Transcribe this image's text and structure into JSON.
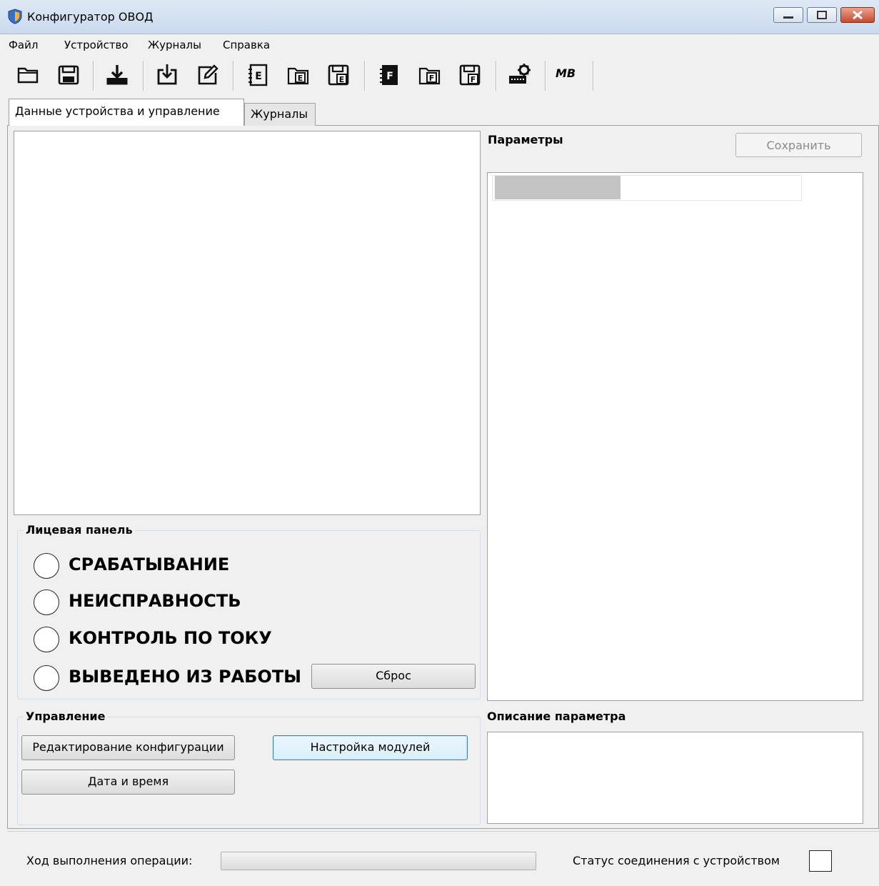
{
  "window": {
    "title": "Конфигуратор ОВОД"
  },
  "menu": {
    "items": [
      "Файл",
      "Устройство",
      "Журналы",
      "Справка"
    ]
  },
  "toolbar": {
    "icons": [
      "open-folder-icon",
      "save-icon",
      "download-icon",
      "import-icon",
      "edit-icon",
      "config-e-icon",
      "open-e-icon",
      "save-e-icon",
      "config-f-icon",
      "open-f-icon",
      "save-f-icon",
      "module-settings-icon",
      "modbus-icon"
    ],
    "modbus_label": "МВ"
  },
  "tabs": {
    "data": "Данные устройства и управление",
    "journals": "Журналы"
  },
  "params": {
    "label": "Параметры",
    "save_button": "Сохранить"
  },
  "front_panel": {
    "title": "Лицевая панель",
    "indicators": [
      "СРАБАТЫВАНИЕ",
      "НЕИСПРАВНОСТЬ",
      "КОНТРОЛЬ ПО ТОКУ",
      "ВЫВЕДЕНО ИЗ РАБОТЫ"
    ],
    "reset_button": "Сброс"
  },
  "control": {
    "title": "Управление",
    "edit_config": "Редактирование конфигурации",
    "modules": "Настройка модулей",
    "datetime": "Дата и время"
  },
  "description": {
    "label": "Описание параметра"
  },
  "status": {
    "progress_label": "Ход выполнения операции:",
    "connection_label": "Статус соединения с устройством"
  }
}
